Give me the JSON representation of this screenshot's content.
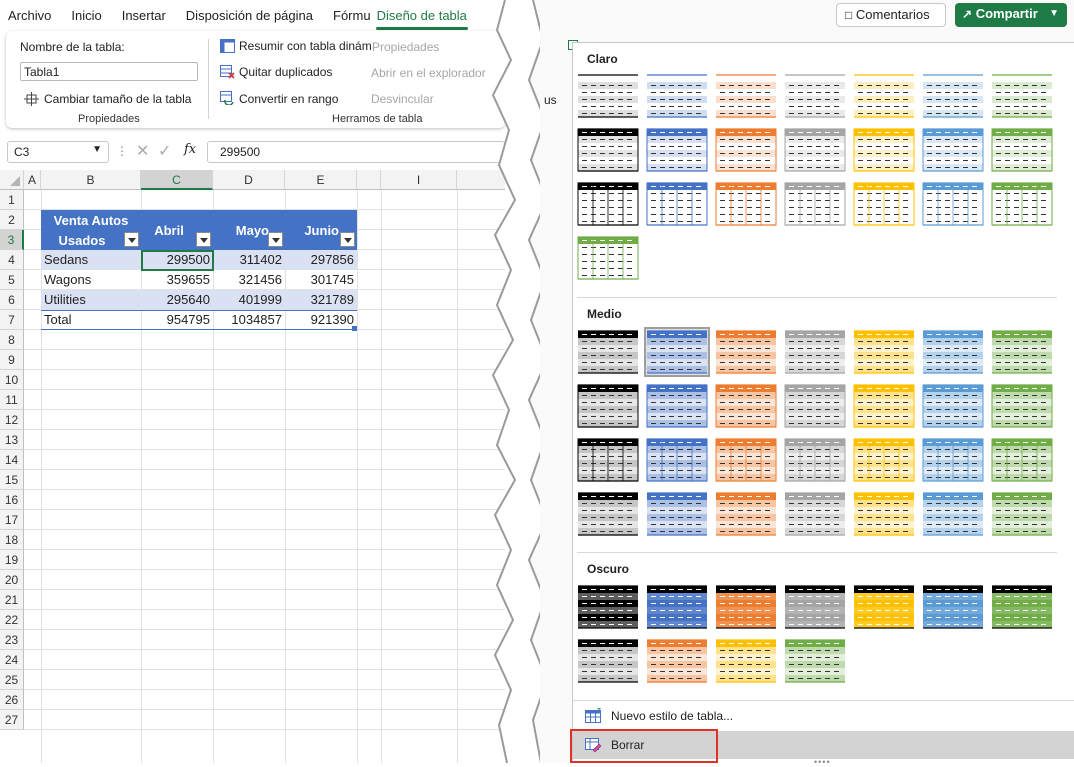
{
  "menu": {
    "tabs": [
      "Archivo",
      "Inicio",
      "Insertar",
      "Disposición de página",
      "Fórmu",
      "Diseño de tabla"
    ],
    "active_tab": "Diseño de tabla"
  },
  "ribbon": {
    "props_name_label": "Nombre de la tabla:",
    "table_name": "Tabla1",
    "resize_label": "Cambiar tamaño de la tabla",
    "props_group": "Propiedades",
    "summarize": "Resumir con tabla dinám",
    "remove_dupes": "Quitar duplicados",
    "convert_range": "Convertir en rango",
    "tools_group": "Herramos de tabla",
    "properties_disabled": "Propiedades",
    "open_browser": "Abrir en el explorador",
    "unlink": "Desvincular"
  },
  "formula_bar": {
    "name_box": "C3",
    "fx": "fx",
    "value": "299500"
  },
  "grid": {
    "columns": [
      "A",
      "B",
      "C",
      "D",
      "E",
      "I"
    ],
    "rows": [
      "1",
      "2",
      "3",
      "4",
      "5",
      "6",
      "7",
      "8",
      "9",
      "10",
      "11",
      "12",
      "13",
      "14",
      "15",
      "16",
      "17",
      "18",
      "19",
      "20",
      "21",
      "22",
      "23",
      "24",
      "25",
      "26",
      "27"
    ],
    "table_header": {
      "b_line1": "Venta Autos",
      "b_line2": "Usados",
      "c": "Abril",
      "d": "Mayo",
      "e": "Junio"
    },
    "table_rows": [
      {
        "label": "Sedans",
        "c": "299500",
        "d": "311402",
        "e": "297856"
      },
      {
        "label": "Wagons",
        "c": "359655",
        "d": "321456",
        "e": "301745"
      },
      {
        "label": "Utilities",
        "c": "295640",
        "d": "401999",
        "e": "321789"
      },
      {
        "label": "Total",
        "c": "954795",
        "d": "1034857",
        "e": "921390"
      }
    ]
  },
  "topbar": {
    "comments": "Comentarios",
    "share": "Compartir",
    "partial_label": "us"
  },
  "gallery": {
    "sections": [
      "Claro",
      "Medio",
      "Oscuro"
    ],
    "new_style": "Nuevo estilo de tabla...",
    "clear": "Borrar"
  },
  "colors": {
    "excel_green": "#1e7b45",
    "table_header_blue": "#4472c4",
    "table_band": "#d9e1f2",
    "highlight_red": "#e0322a",
    "swatch_palette": [
      "#000000",
      "#4472c4",
      "#ed7d31",
      "#a5a5a5",
      "#ffc000",
      "#5b9bd5",
      "#70ad47"
    ]
  }
}
